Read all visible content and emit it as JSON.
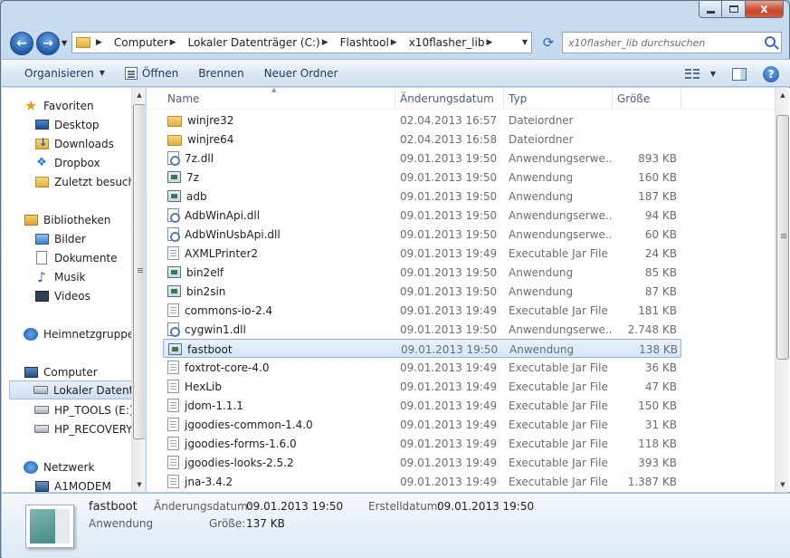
{
  "window": {
    "close_glyph": "x"
  },
  "address": {
    "crumbs": [
      "Computer",
      "Lokaler Datenträger (C:)",
      "Flashtool",
      "x10flasher_lib"
    ],
    "search_placeholder": "x10flasher_lib durchsuchen"
  },
  "toolbar": {
    "organize": "Organisieren",
    "open": "Öffnen",
    "burn": "Brennen",
    "new_folder": "Neuer Ordner"
  },
  "nav": {
    "favorites": {
      "label": "Favoriten",
      "items": [
        "Desktop",
        "Downloads",
        "Dropbox",
        "Zuletzt besucht"
      ]
    },
    "libraries": {
      "label": "Bibliotheken",
      "items": [
        "Bilder",
        "Dokumente",
        "Musik",
        "Videos"
      ]
    },
    "homegroup": "Heimnetzgruppe",
    "computer": {
      "label": "Computer",
      "items": [
        "Lokaler Datenträ",
        "HP_TOOLS (E:)",
        "HP_RECOVERY ("
      ]
    },
    "network": {
      "label": "Netzwerk",
      "items": [
        "A1MODEM"
      ]
    }
  },
  "columns": {
    "name": "Name",
    "date": "Änderungsdatum",
    "type": "Typ",
    "size": "Größe"
  },
  "files": [
    {
      "name": "winjre32",
      "date": "02.04.2013 16:57",
      "type": "Dateiordner",
      "size": "",
      "icon": "folder"
    },
    {
      "name": "winjre64",
      "date": "02.04.2013 16:58",
      "type": "Dateiordner",
      "size": "",
      "icon": "folder"
    },
    {
      "name": "7z.dll",
      "date": "09.01.2013 19:50",
      "type": "Anwendungserwe...",
      "size": "893 KB",
      "icon": "dll"
    },
    {
      "name": "7z",
      "date": "09.01.2013 19:50",
      "type": "Anwendung",
      "size": "160 KB",
      "icon": "exe"
    },
    {
      "name": "adb",
      "date": "09.01.2013 19:50",
      "type": "Anwendung",
      "size": "187 KB",
      "icon": "exe"
    },
    {
      "name": "AdbWinApi.dll",
      "date": "09.01.2013 19:50",
      "type": "Anwendungserwe...",
      "size": "94 KB",
      "icon": "dll"
    },
    {
      "name": "AdbWinUsbApi.dll",
      "date": "09.01.2013 19:50",
      "type": "Anwendungserwe...",
      "size": "60 KB",
      "icon": "dll"
    },
    {
      "name": "AXMLPrinter2",
      "date": "09.01.2013 19:49",
      "type": "Executable Jar File",
      "size": "24 KB",
      "icon": "jar"
    },
    {
      "name": "bin2elf",
      "date": "09.01.2013 19:50",
      "type": "Anwendung",
      "size": "85 KB",
      "icon": "exe"
    },
    {
      "name": "bin2sin",
      "date": "09.01.2013 19:50",
      "type": "Anwendung",
      "size": "87 KB",
      "icon": "exe"
    },
    {
      "name": "commons-io-2.4",
      "date": "09.01.2013 19:49",
      "type": "Executable Jar File",
      "size": "181 KB",
      "icon": "jar"
    },
    {
      "name": "cygwin1.dll",
      "date": "09.01.2013 19:50",
      "type": "Anwendungserwe...",
      "size": "2.748 KB",
      "icon": "dll"
    },
    {
      "name": "fastboot",
      "date": "09.01.2013 19:50",
      "type": "Anwendung",
      "size": "138 KB",
      "icon": "exe",
      "selected": true
    },
    {
      "name": "foxtrot-core-4.0",
      "date": "09.01.2013 19:49",
      "type": "Executable Jar File",
      "size": "36 KB",
      "icon": "jar"
    },
    {
      "name": "HexLib",
      "date": "09.01.2013 19:49",
      "type": "Executable Jar File",
      "size": "47 KB",
      "icon": "jar"
    },
    {
      "name": "jdom-1.1.1",
      "date": "09.01.2013 19:49",
      "type": "Executable Jar File",
      "size": "150 KB",
      "icon": "jar"
    },
    {
      "name": "jgoodies-common-1.4.0",
      "date": "09.01.2013 19:49",
      "type": "Executable Jar File",
      "size": "31 KB",
      "icon": "jar"
    },
    {
      "name": "jgoodies-forms-1.6.0",
      "date": "09.01.2013 19:49",
      "type": "Executable Jar File",
      "size": "118 KB",
      "icon": "jar"
    },
    {
      "name": "jgoodies-looks-2.5.2",
      "date": "09.01.2013 19:49",
      "type": "Executable Jar File",
      "size": "393 KB",
      "icon": "jar"
    },
    {
      "name": "jna-3.4.2",
      "date": "09.01.2013 19:49",
      "type": "Executable Jar File",
      "size": "1.387 KB",
      "icon": "jar"
    }
  ],
  "details": {
    "name": "fastboot",
    "kind": "Anwendung",
    "modified_label": "Änderungsdatum:",
    "modified_value": "09.01.2013 19:50",
    "created_label": "Erstelldatum:",
    "created_value": "09.01.2013 19:50",
    "size_label": "Größe:",
    "size_value": "137 KB"
  }
}
